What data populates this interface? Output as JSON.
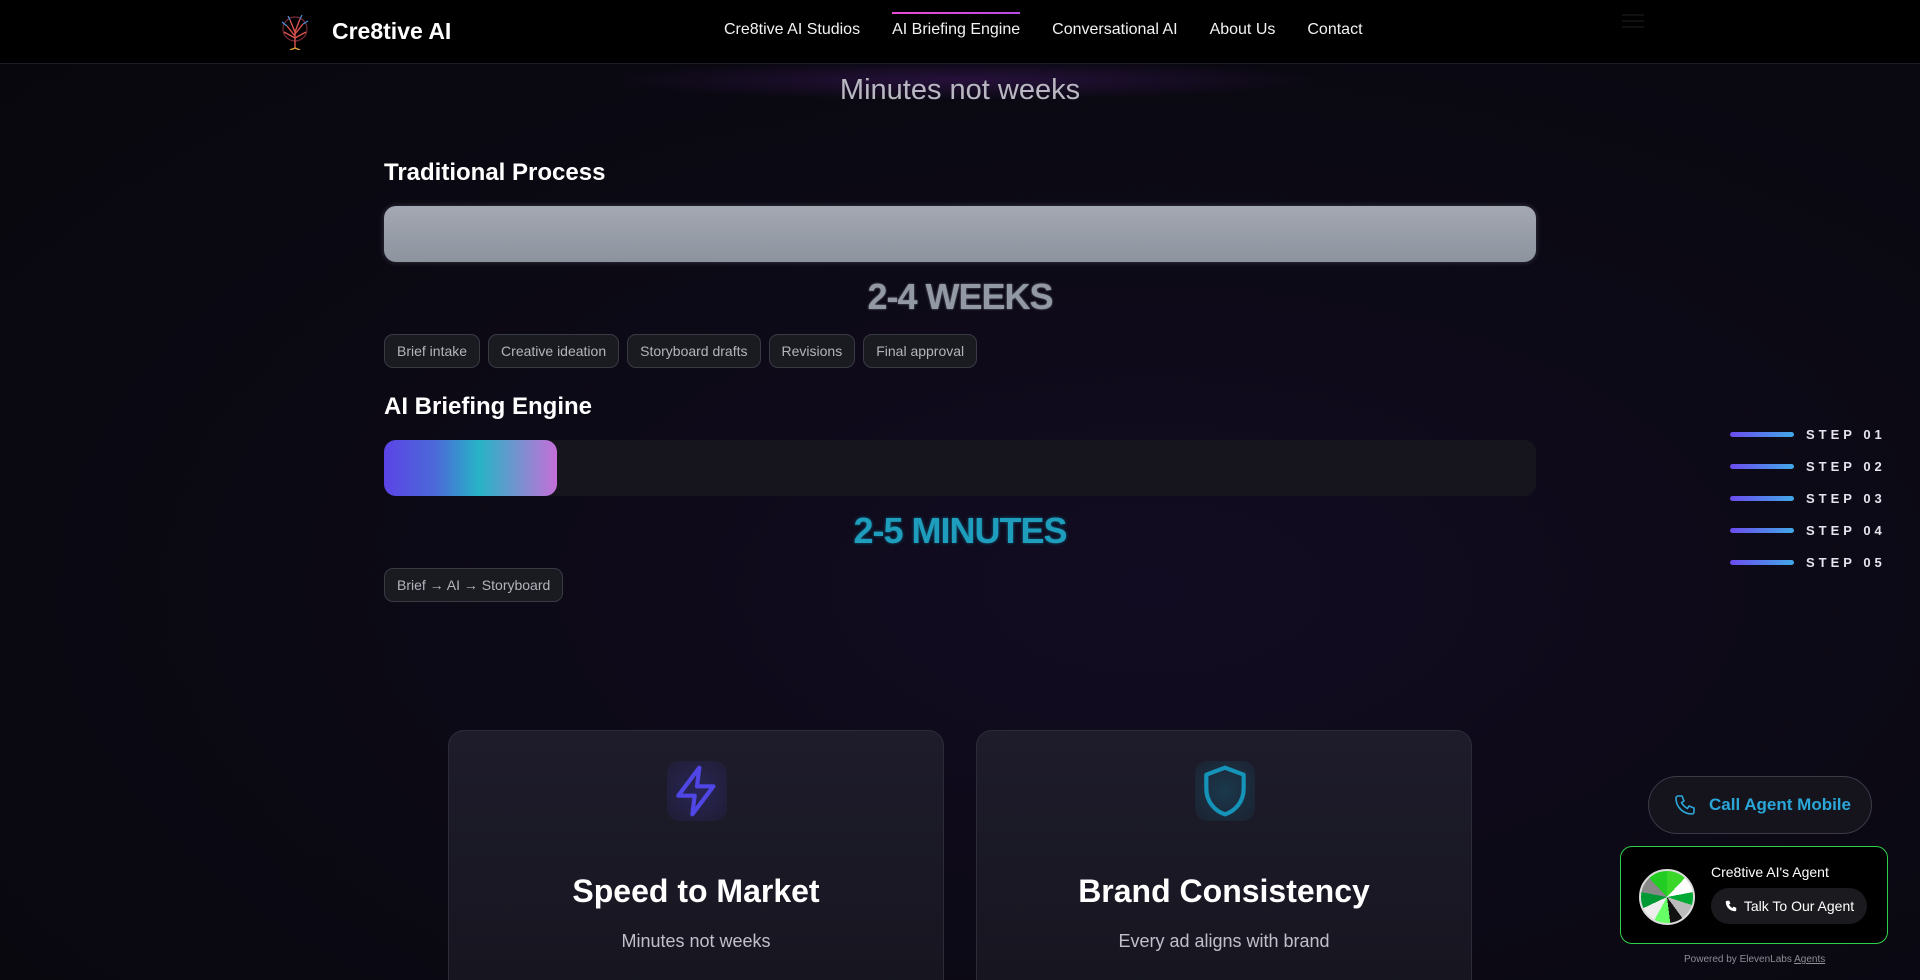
{
  "header": {
    "brand": "Cre8tive AI",
    "nav": [
      {
        "label": "Cre8tive AI Studios"
      },
      {
        "label": "AI Briefing Engine"
      },
      {
        "label": "Conversational AI"
      },
      {
        "label": "About Us"
      },
      {
        "label": "Contact"
      }
    ],
    "active_nav": "AI Briefing Engine"
  },
  "hero": {
    "subtitle": "Minutes not weeks"
  },
  "traditional": {
    "title": "Traditional Process",
    "duration": "2-4 WEEKS",
    "bar_fill_fraction": 1.0,
    "steps": [
      "Brief intake",
      "Creative ideation",
      "Storyboard drafts",
      "Revisions",
      "Final approval"
    ]
  },
  "ai": {
    "title": "AI Briefing Engine",
    "duration": "2-5 MINUTES",
    "bar_fill_fraction": 0.15,
    "steps": [
      "Brief → AI → Storyboard"
    ]
  },
  "step_nav": [
    "STEP 01",
    "STEP 02",
    "STEP 03",
    "STEP 04",
    "STEP 05"
  ],
  "cards": [
    {
      "icon": "lightning-icon",
      "title": "Speed to Market",
      "text": "Minutes not weeks",
      "accent": "#4f46e5"
    },
    {
      "icon": "shield-icon",
      "title": "Brand Consistency",
      "text": "Every ad aligns with brand",
      "accent": "#1593b8"
    }
  ],
  "call_button": {
    "label": "Call Agent Mobile",
    "icon": "phone-icon"
  },
  "agent_widget": {
    "name": "Cre8tive AI's Agent",
    "talk_label": "Talk To Our Agent",
    "powered_prefix": "Powered by ElevenLabs",
    "powered_link": "Agents"
  },
  "colors": {
    "accent_pink": "#ec4bd4",
    "cyan": "#1e9dbd",
    "widget_border": "#2fd14a"
  }
}
